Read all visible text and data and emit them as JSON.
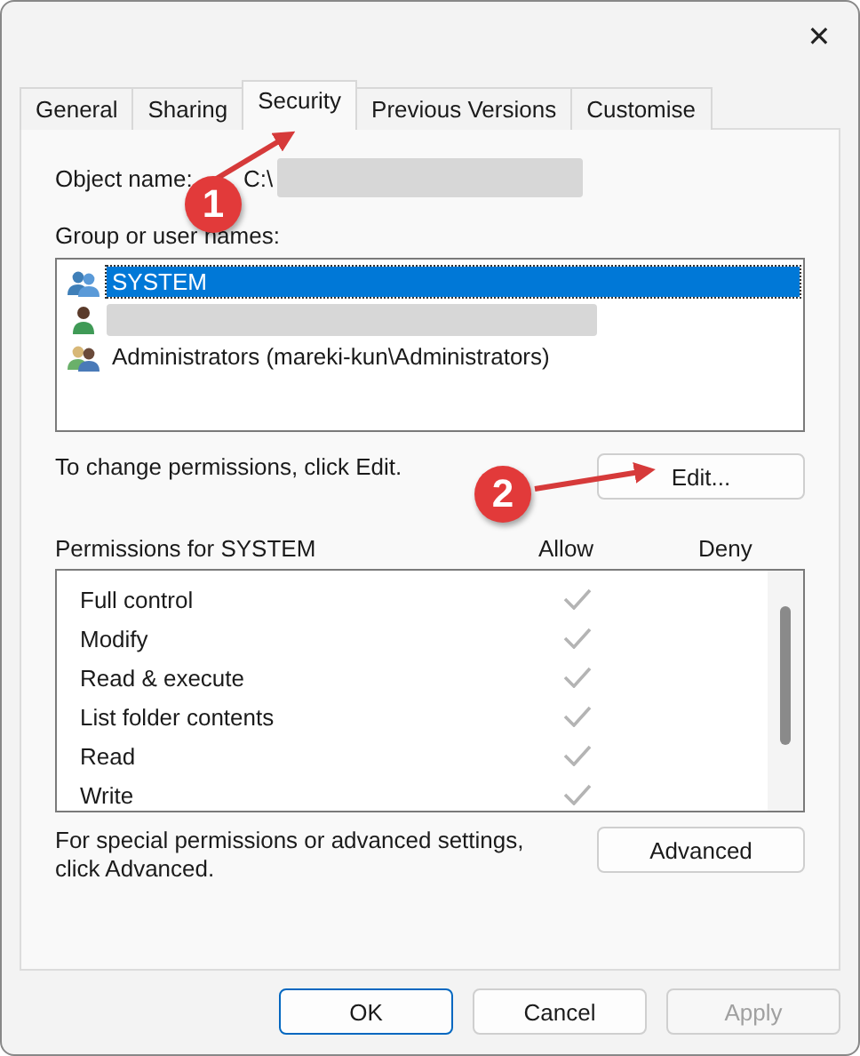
{
  "window": {
    "close": "✕"
  },
  "tabs": [
    {
      "label": "General",
      "selected": false
    },
    {
      "label": "Sharing",
      "selected": false
    },
    {
      "label": "Security",
      "selected": true
    },
    {
      "label": "Previous Versions",
      "selected": false
    },
    {
      "label": "Customise",
      "selected": false
    }
  ],
  "object_name": {
    "label": "Object name:",
    "value": "C:\\",
    "redacted": true
  },
  "groups": {
    "label": "Group or user names:",
    "items": [
      {
        "kind": "group",
        "name": "SYSTEM",
        "selected": true,
        "redacted": false
      },
      {
        "kind": "user",
        "selected": false,
        "redacted": true
      },
      {
        "kind": "admins",
        "name": "Administrators (mareki-kun\\Administrators)",
        "selected": false,
        "redacted": false
      }
    ]
  },
  "change_hint": "To change permissions, click Edit.",
  "edit_button": "Edit...",
  "permissions": {
    "title": "Permissions for SYSTEM",
    "allow_label": "Allow",
    "deny_label": "Deny",
    "rows": [
      {
        "name": "Full control",
        "allow": true
      },
      {
        "name": "Modify",
        "allow": true
      },
      {
        "name": "Read & execute",
        "allow": true
      },
      {
        "name": "List folder contents",
        "allow": true
      },
      {
        "name": "Read",
        "allow": true
      },
      {
        "name": "Write",
        "allow": true
      }
    ]
  },
  "advanced_hint": "For special permissions or advanced settings, click Advanced.",
  "advanced_button": "Advanced",
  "buttons": [
    {
      "label": "OK",
      "disabled": false,
      "default": true
    },
    {
      "label": "Cancel",
      "disabled": false,
      "default": false
    },
    {
      "label": "Apply",
      "disabled": true,
      "default": false
    }
  ],
  "callouts": [
    {
      "number": "1"
    },
    {
      "number": "2"
    }
  ]
}
